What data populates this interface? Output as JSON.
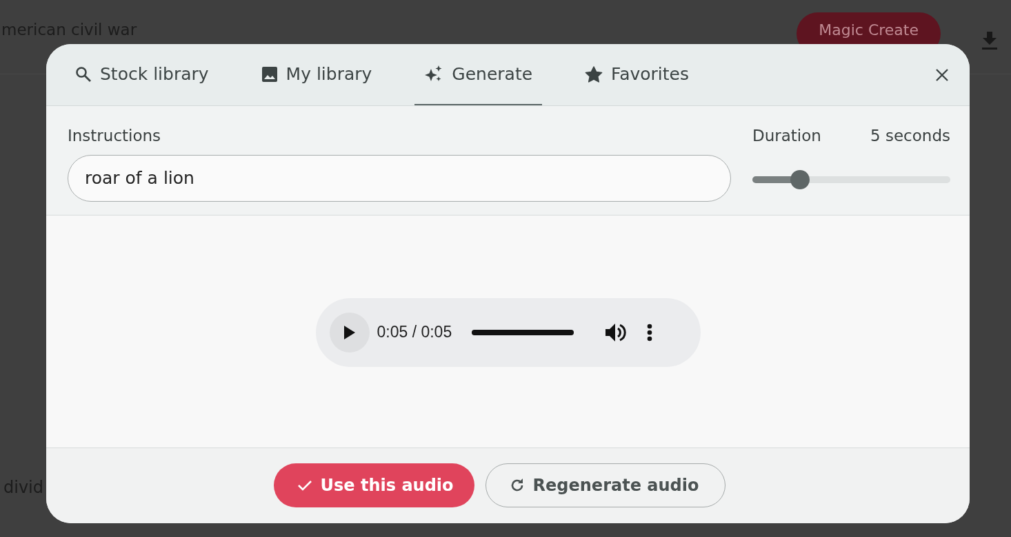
{
  "background": {
    "title": "merican civil war",
    "magic_button": "Magic Create",
    "side_text": "divid"
  },
  "tabs": [
    {
      "label": "Stock library",
      "kind": "search",
      "selected": false
    },
    {
      "label": "My library",
      "kind": "image",
      "selected": false
    },
    {
      "label": "Generate",
      "kind": "sparkle",
      "selected": true
    },
    {
      "label": "Favorites",
      "kind": "star",
      "selected": false
    }
  ],
  "instructions": {
    "label": "Instructions",
    "value": "roar of a lion"
  },
  "duration": {
    "label": "Duration",
    "reading": "5 seconds",
    "level": 0.24
  },
  "player": {
    "time": "0:05 / 0:05",
    "level": 1
  },
  "buttons": [
    {
      "label": "Use this audio",
      "kind": "primary"
    },
    {
      "label": "Regenerate audio",
      "kind": "secondary"
    }
  ]
}
